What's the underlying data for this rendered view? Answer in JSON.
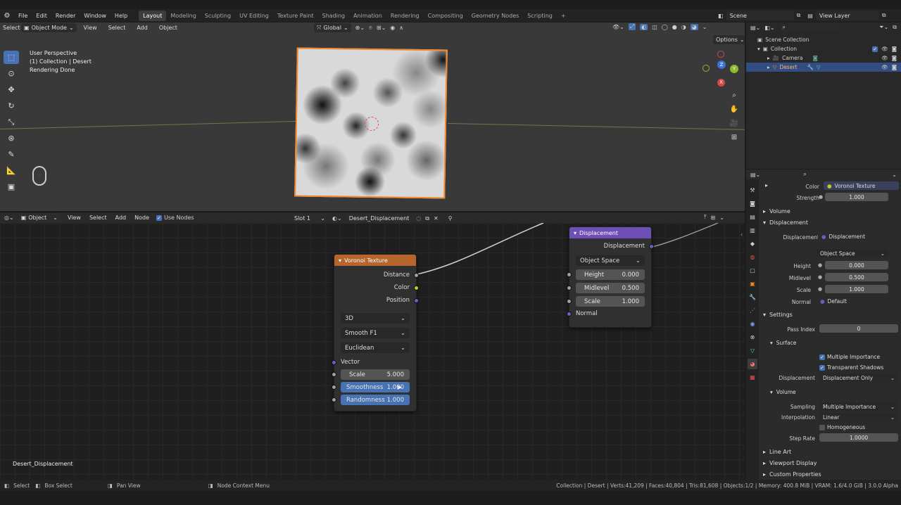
{
  "menus": [
    "File",
    "Edit",
    "Render",
    "Window",
    "Help"
  ],
  "workspaces": [
    "Layout",
    "Modeling",
    "Sculpting",
    "UV Editing",
    "Texture Paint",
    "Shading",
    "Animation",
    "Rendering",
    "Compositing",
    "Geometry Nodes",
    "Scripting"
  ],
  "active_workspace": "Layout",
  "scene": "Scene",
  "view_layer": "View Layer",
  "viewport": {
    "select_box": "Select Box",
    "mode": "Object Mode",
    "menus": [
      "View",
      "Select",
      "Add",
      "Object"
    ],
    "transform_orientation": "Global",
    "options": "Options",
    "info_line1": "User Perspective",
    "info_line2": "(1) Collection | Desert",
    "info_line3": "Rendering Done",
    "gizmo_axes": {
      "x": "X",
      "y": "Y",
      "z": "Z"
    }
  },
  "outliner": {
    "root": "Scene Collection",
    "collection": "Collection",
    "items": [
      {
        "name": "Camera",
        "icon": "camera-icon"
      },
      {
        "name": "Desert",
        "icon": "mesh-icon",
        "selected": true
      }
    ]
  },
  "node_editor": {
    "type_menu": "Object",
    "menus": [
      "View",
      "Select",
      "Add",
      "Node"
    ],
    "use_nodes": "Use Nodes",
    "slot": "Slot 1",
    "material": "Desert_Displacement",
    "footer_label": "Desert_Displacement",
    "voronoi": {
      "title": "Voronoi Texture",
      "outputs": [
        "Distance",
        "Color",
        "Position"
      ],
      "dimensions": "3D",
      "feature": "Smooth F1",
      "metric": "Euclidean",
      "vector_label": "Vector",
      "fields": [
        {
          "label": "Scale",
          "value": "5.000"
        },
        {
          "label": "Smoothness",
          "value": "1.000"
        },
        {
          "label": "Randomness",
          "value": "1.000"
        }
      ]
    },
    "displacement": {
      "title": "Displacement",
      "output": "Displacement",
      "space": "Object Space",
      "fields": [
        {
          "label": "Height",
          "value": "0.000"
        },
        {
          "label": "Midlevel",
          "value": "0.500"
        },
        {
          "label": "Scale",
          "value": "1.000"
        }
      ],
      "normal_label": "Normal"
    }
  },
  "properties": {
    "color_label": "Color",
    "color_link": "Voronoi Texture",
    "strength_label": "Strength",
    "strength_value": "1.000",
    "volume_section": "Volume",
    "displacement_section": "Displacement",
    "disp_label": "Displacement",
    "disp_link": "Displacement",
    "space": "Object Space",
    "height_label": "Height",
    "height_value": "0.000",
    "midlevel_label": "Midlevel",
    "midlevel_value": "0.500",
    "scale_label": "Scale",
    "scale_value": "1.000",
    "normal_label": "Normal",
    "normal_value": "Default",
    "settings_section": "Settings",
    "pass_index_label": "Pass Index",
    "pass_index_value": "0",
    "surface_section": "Surface",
    "multiple_importance": "Multiple Importance",
    "transparent_shadows": "Transparent Shadows",
    "displacement_method_label": "Displacement",
    "displacement_method": "Displacement Only",
    "volume_sub": "Volume",
    "sampling_label": "Sampling",
    "sampling_value": "Multiple Importance",
    "interpolation_label": "Interpolation",
    "interpolation_value": "Linear",
    "homogeneous": "Homogeneous",
    "step_rate_label": "Step Rate",
    "step_rate_value": "1.0000",
    "line_art": "Line Art",
    "viewport_display": "Viewport Display",
    "custom_properties": "Custom Properties"
  },
  "status": {
    "select": "Select",
    "box_select": "Box Select",
    "pan_view": "Pan View",
    "context_menu": "Node Context Menu",
    "stats": "Collection | Desert | Verts:41,209 | Faces:40,804 | Tris:81,608 | Objects:1/2 | Memory: 400.8 MiB | VRAM: 1.6/4.0 GiB | 3.0.0 Alpha"
  },
  "colors": {
    "accent": "#4772b3",
    "selection_orange": "#f5892a",
    "voronoi_header": "#b6652c",
    "displacement_header": "#6e4fb5",
    "socket_grey": "#a1a1a1",
    "socket_yellow": "#c7c729",
    "socket_purple": "#6363c7"
  }
}
